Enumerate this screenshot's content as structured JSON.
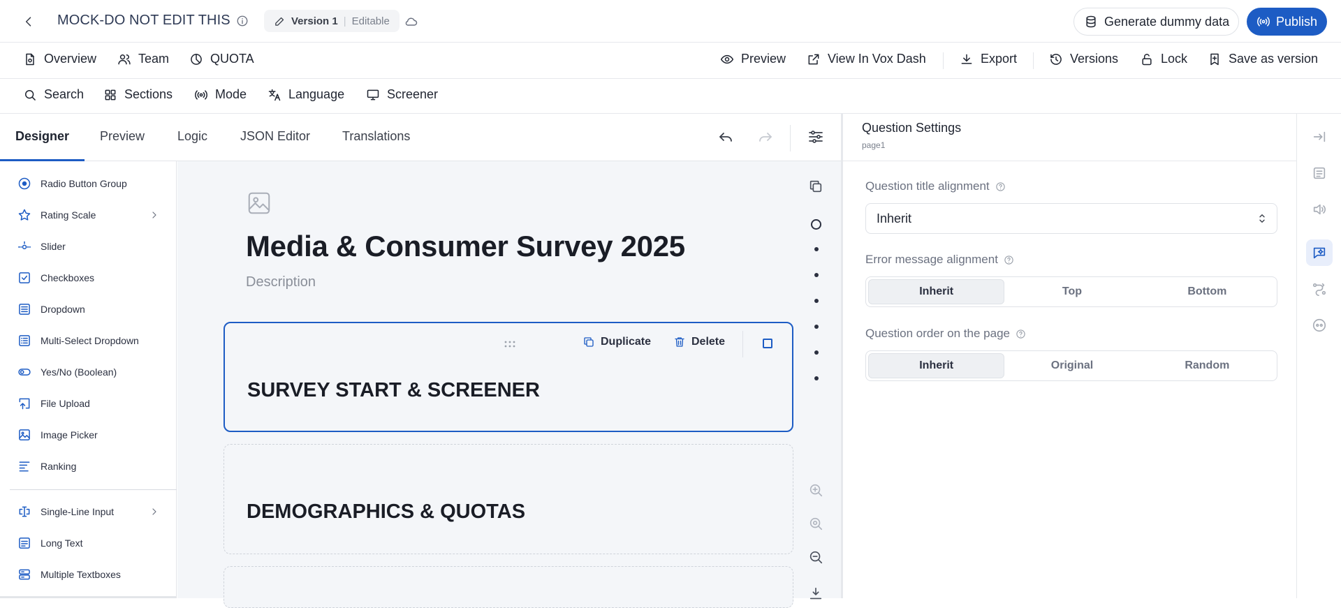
{
  "header": {
    "title": "MOCK-DO NOT EDIT THIS",
    "version_label": "Version 1",
    "version_state": "Editable",
    "generate_label": "Generate dummy data",
    "publish_label": "Publish"
  },
  "navbar": {
    "overview": "Overview",
    "team": "Team",
    "quota": "QUOTA",
    "preview": "Preview",
    "view_vox": "View In Vox Dash",
    "export": "Export",
    "versions": "Versions",
    "lock": "Lock",
    "save_version": "Save as version"
  },
  "toolbar": {
    "search": "Search",
    "sections": "Sections",
    "mode": "Mode",
    "language": "Language",
    "screener": "Screener"
  },
  "tabs": [
    "Designer",
    "Preview",
    "Logic",
    "JSON Editor",
    "Translations"
  ],
  "toolbox": {
    "items": [
      {
        "label": "Radio Button Group",
        "icon": "radio-icon"
      },
      {
        "label": "Rating Scale",
        "icon": "star-icon"
      },
      {
        "label": "Slider",
        "icon": "slider-icon"
      },
      {
        "label": "Checkboxes",
        "icon": "checkbox-icon"
      },
      {
        "label": "Dropdown",
        "icon": "dropdown-icon"
      },
      {
        "label": "Multi-Select Dropdown",
        "icon": "multi-dropdown-icon"
      },
      {
        "label": "Yes/No (Boolean)",
        "icon": "toggle-icon"
      },
      {
        "label": "File Upload",
        "icon": "upload-icon"
      },
      {
        "label": "Image Picker",
        "icon": "image-picker-icon"
      },
      {
        "label": "Ranking",
        "icon": "ranking-icon"
      },
      {
        "label": "Single-Line Input",
        "icon": "text-cursor-icon"
      },
      {
        "label": "Long Text",
        "icon": "long-text-icon"
      },
      {
        "label": "Multiple Textboxes",
        "icon": "multi-textbox-icon"
      }
    ]
  },
  "canvas": {
    "form_title": "Media & Consumer Survey 2025",
    "form_description": "Description",
    "pages": [
      {
        "title": "SURVEY START & SCREENER"
      },
      {
        "title": "DEMOGRAPHICS & QUOTAS"
      }
    ],
    "duplicate_label": "Duplicate",
    "delete_label": "Delete"
  },
  "settings": {
    "title": "Question Settings",
    "subtitle": "page1",
    "title_alignment": {
      "label": "Question title alignment",
      "value": "Inherit"
    },
    "error_alignment": {
      "label": "Error message alignment",
      "options": [
        "Inherit",
        "Top",
        "Bottom"
      ],
      "selected": "Inherit"
    },
    "question_order": {
      "label": "Question order on the page",
      "options": [
        "Inherit",
        "Original",
        "Random"
      ],
      "selected": "Inherit"
    }
  },
  "colors": {
    "accent": "#1d5cc4",
    "canvas_bg": "#f4f6f9"
  }
}
